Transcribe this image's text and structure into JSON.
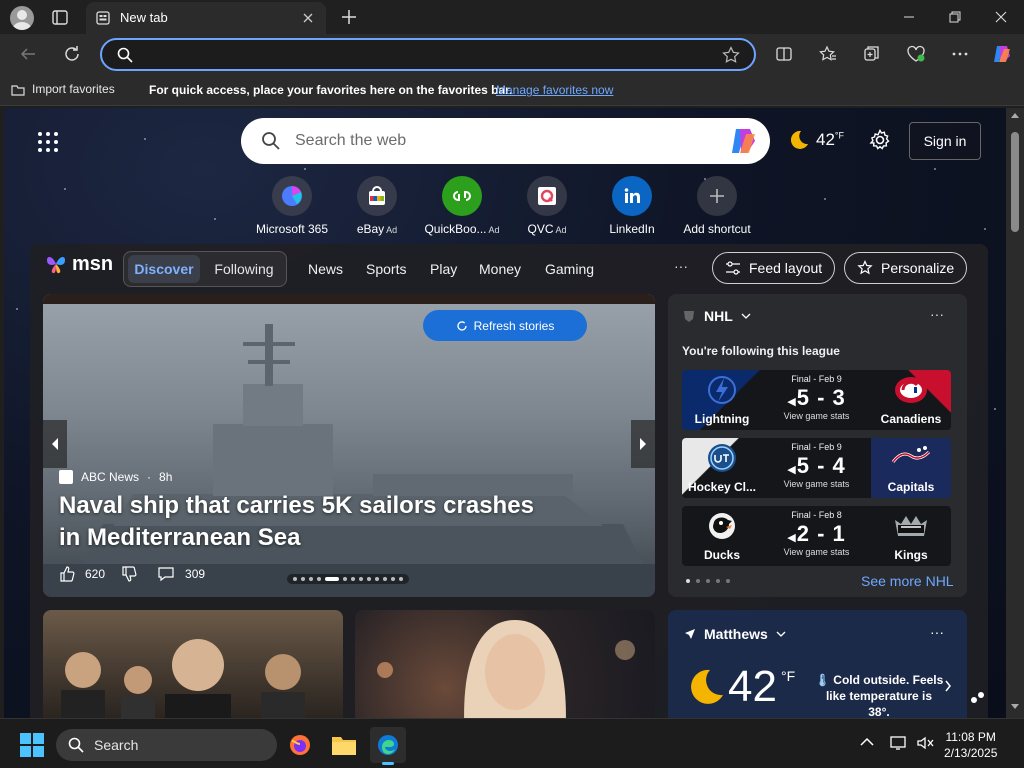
{
  "browser": {
    "tab_title": "New tab",
    "address_placeholder": ""
  },
  "favorites_bar": {
    "import_label": "Import favorites",
    "hint": "For quick access, place your favorites here on the favorites bar.",
    "manage_link": "Manage favorites now"
  },
  "msn_top": {
    "search_placeholder": "Search the web",
    "weather_temp": "42",
    "weather_unit": "°F",
    "sign_in": "Sign in"
  },
  "shortcuts": [
    {
      "label": "Microsoft 365",
      "ad": ""
    },
    {
      "label": "eBay",
      "ad": "Ad"
    },
    {
      "label": "QuickBoo...",
      "ad": "Ad"
    },
    {
      "label": "QVC",
      "ad": "Ad"
    },
    {
      "label": "LinkedIn",
      "ad": ""
    },
    {
      "label": "Add shortcut",
      "ad": ""
    }
  ],
  "feed": {
    "logo_text": "msn",
    "tab_discover": "Discover",
    "tab_following": "Following",
    "categories": [
      "News",
      "Sports",
      "Play",
      "Money",
      "Gaming"
    ],
    "more": "···",
    "feed_layout": "Feed layout",
    "personalize": "Personalize"
  },
  "hero": {
    "refresh": "Refresh stories",
    "source": "ABC News",
    "age": "8h",
    "title": "Naval ship that carries 5K sailors crashes in Mediterranean Sea",
    "likes": "620",
    "comments": "309"
  },
  "nhl": {
    "league": "NHL",
    "more": "···",
    "following": "You're following this league",
    "games": [
      {
        "status": "Final - Feb 9",
        "score": "5 - 3",
        "stats": "View game stats",
        "home": "Lightning",
        "away": "Canadiens"
      },
      {
        "status": "Final - Feb 9",
        "score": "5 - 4",
        "stats": "View game stats",
        "home": "Hockey Cl...",
        "away": "Capitals"
      },
      {
        "status": "Final - Feb 8",
        "score": "2 - 1",
        "stats": "View game stats",
        "home": "Ducks",
        "away": "Kings"
      }
    ],
    "see_more": "See more NHL"
  },
  "weather_card": {
    "location": "Matthews",
    "more": "···",
    "temp": "42",
    "unit": "°F",
    "desc": "Cold outside. Feels like temperature is 38°."
  },
  "taskbar": {
    "search": "Search",
    "time": "11:08 PM",
    "date": "2/13/2025"
  },
  "colors": {
    "accent": "#1c6fd6",
    "link": "#6ea8ff",
    "address_focus": "#6ea4ff"
  }
}
